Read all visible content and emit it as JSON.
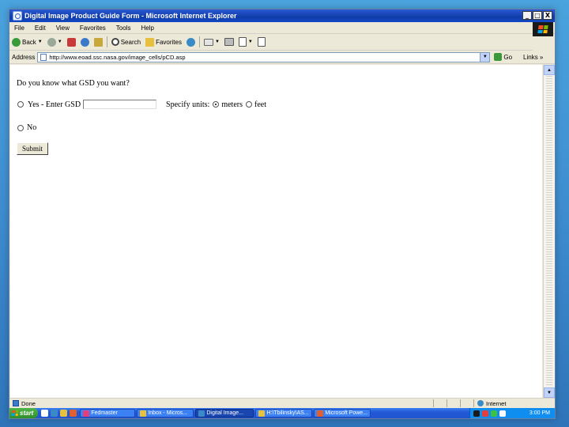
{
  "window": {
    "title": "Digital Image Product Guide Form - Microsoft Internet Explorer",
    "controls": {
      "minimize": "_",
      "maximize": "□",
      "close": "X"
    }
  },
  "menu": [
    "File",
    "Edit",
    "View",
    "Favorites",
    "Tools",
    "Help"
  ],
  "toolbar": {
    "back_label": "Back",
    "search_label": "Search",
    "favorites_label": "Favorites"
  },
  "address": {
    "label": "Address",
    "url": "http://www.eoad.ssc.nasa.gov/image_cells/pCD.asp",
    "go_label": "Go",
    "links_label": "Links »"
  },
  "form": {
    "question": "Do you know what GSD you want?",
    "yes_label": "Yes - Enter GSD",
    "gsd_value": "",
    "units_label": "Specify units:",
    "unit_options": [
      "meters",
      "feet"
    ],
    "unit_selected": "meters",
    "no_label": "No",
    "submit_label": "Submit"
  },
  "status": {
    "text": "Done",
    "zone": "Internet"
  },
  "taskbar": {
    "start_label": "start",
    "tasks": [
      {
        "label": "Fedmaster",
        "color": "#e04080",
        "active": false
      },
      {
        "label": "Inbox - Micros...",
        "color": "#e8c040",
        "active": false
      },
      {
        "label": "Digital Image...",
        "color": "#3a8ac8",
        "active": true
      },
      {
        "label": "H:\\Tbilinsky\\AS...",
        "color": "#e8c040",
        "active": false
      },
      {
        "label": "Microsoft Powe...",
        "color": "#e06030",
        "active": false
      }
    ],
    "clock": "3:00 PM"
  },
  "colors": {
    "titlebar": "#0f3ca8",
    "taskbar": "#2155d0",
    "start_button": "#2f8f2a",
    "desktop": "#3f8fd0"
  }
}
